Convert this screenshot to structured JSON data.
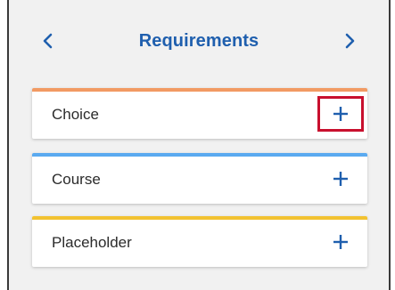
{
  "header": {
    "title": "Requirements",
    "prev_icon": "chevron-left-icon",
    "next_icon": "chevron-right-icon"
  },
  "colors": {
    "title": "#1f5fae",
    "icon": "#1f5fae",
    "highlight_border": "#c8102e"
  },
  "items": [
    {
      "label": "Choice",
      "accent": "#f29a63",
      "icon": "plus-icon",
      "highlighted": true
    },
    {
      "label": "Course",
      "accent": "#5aaaf0",
      "icon": "plus-icon",
      "highlighted": false
    },
    {
      "label": "Placeholder",
      "accent": "#f2c230",
      "icon": "plus-icon",
      "highlighted": false
    }
  ]
}
